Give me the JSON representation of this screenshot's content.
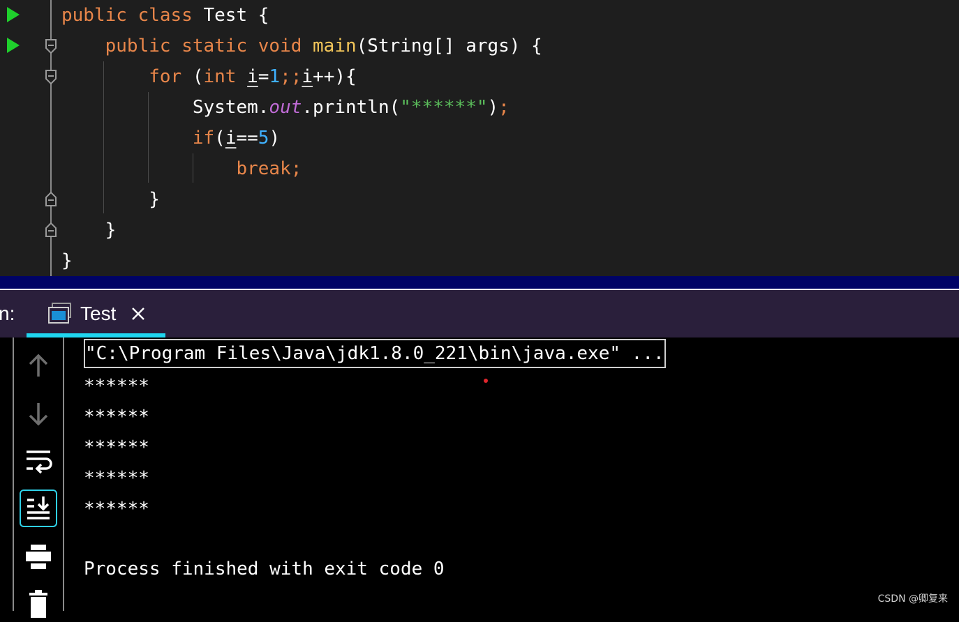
{
  "editor": {
    "lines": [
      [
        {
          "t": "public class ",
          "c": "kw"
        },
        {
          "t": "Test {",
          "c": ""
        }
      ],
      [
        {
          "t": "    public static void ",
          "c": "kw"
        },
        {
          "t": "main",
          "c": "fn"
        },
        {
          "t": "(String[] args) {",
          "c": ""
        }
      ],
      [
        {
          "t": "        for ",
          "c": "kw"
        },
        {
          "t": "(",
          "c": ""
        },
        {
          "t": "int ",
          "c": "kw"
        },
        {
          "t": "i",
          "c": "var"
        },
        {
          "t": "=",
          "c": ""
        },
        {
          "t": "1",
          "c": "num"
        },
        {
          "t": ";;",
          "c": "semi"
        },
        {
          "t": "i",
          "c": "var"
        },
        {
          "t": "++){",
          "c": ""
        }
      ],
      [
        {
          "t": "            System.",
          "c": ""
        },
        {
          "t": "out",
          "c": "fld"
        },
        {
          "t": ".println(",
          "c": ""
        },
        {
          "t": "\"******\"",
          "c": "str"
        },
        {
          "t": ")",
          "c": ""
        },
        {
          "t": ";",
          "c": "semi"
        }
      ],
      [
        {
          "t": "            if",
          "c": "kw"
        },
        {
          "t": "(",
          "c": ""
        },
        {
          "t": "i",
          "c": "var"
        },
        {
          "t": "==",
          "c": ""
        },
        {
          "t": "5",
          "c": "num"
        },
        {
          "t": ")",
          "c": ""
        }
      ],
      [
        {
          "t": "                break",
          "c": "kw"
        },
        {
          "t": ";",
          "c": "semi"
        }
      ],
      [
        {
          "t": "        }",
          "c": ""
        }
      ],
      [
        {
          "t": "    }",
          "c": ""
        }
      ],
      [
        {
          "t": "}",
          "c": ""
        }
      ]
    ]
  },
  "run_window": {
    "label": "n:",
    "tab_label": "Test",
    "tab_icon": "console-window-icon",
    "close_icon": "close-icon"
  },
  "toolbar": {
    "items": [
      "up-arrow-icon",
      "down-arrow-icon",
      "soft-wrap-icon",
      "scroll-to-end-icon",
      "print-icon",
      "trash-icon"
    ]
  },
  "console": {
    "command": "\"C:\\Program Files\\Java\\jdk1.8.0_221\\bin\\java.exe\" ...",
    "output": [
      "******",
      "******",
      "******",
      "******",
      "******"
    ],
    "blank": "",
    "exit_message": "Process finished with exit code 0"
  },
  "watermark": "CSDN @卿复来",
  "colors": {
    "keyword": "#e8864a",
    "method": "#f3c65a",
    "number": "#3fb1ff",
    "string": "#5bbd5b",
    "field": "#c06bd6",
    "tab_accent": "#1fd6f0",
    "run_green": "#1fd02c"
  }
}
